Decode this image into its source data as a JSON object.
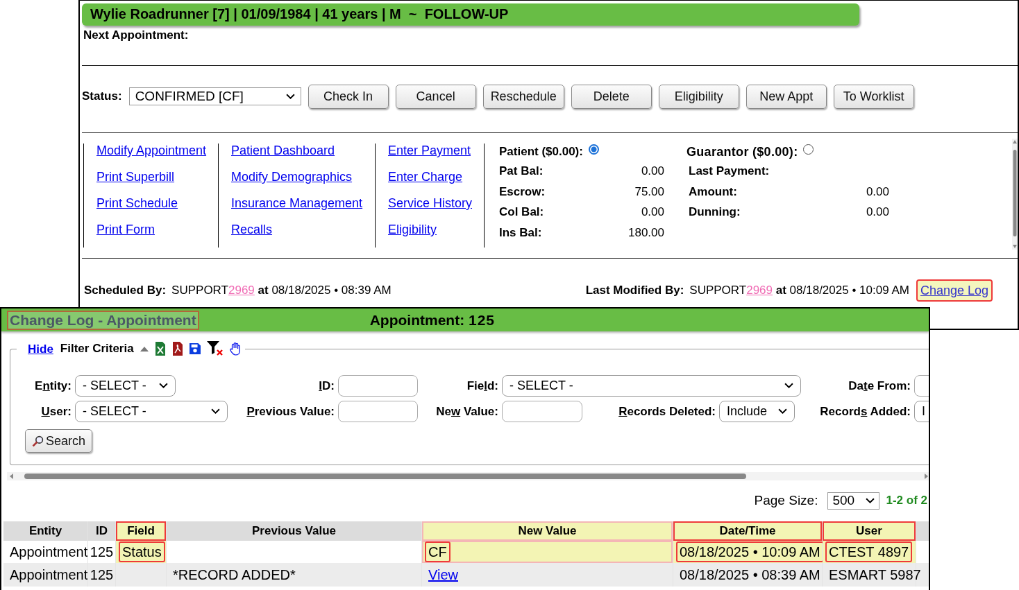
{
  "appointment_window": {
    "banner": "Wylie Roadrunner [7] | 01/09/1984 | 41 years | M  ~  FOLLOW-UP",
    "next_appointment_label": "Next Appointment:",
    "status": {
      "label": "Status:",
      "value": "CONFIRMED [CF]"
    },
    "buttons": [
      "Check In",
      "Cancel",
      "Reschedule",
      "Delete",
      "Eligibility",
      "New Appt",
      "To Worklist"
    ],
    "link_columns": [
      [
        "Modify Appointment",
        "Print Superbill",
        "Print Schedule",
        "Print Form"
      ],
      [
        "Patient Dashboard",
        "Modify Demographics",
        "Insurance Management",
        "Recalls"
      ],
      [
        "Enter Payment",
        "Enter Charge",
        "Service History",
        "Eligibility"
      ]
    ],
    "balances": [
      {
        "label": "Patient ($0.00):",
        "selected": true,
        "rows": [
          {
            "label": "Pat Bal:",
            "value": "0.00"
          },
          {
            "label": "Escrow:",
            "value": "75.00"
          },
          {
            "label": "Col Bal:",
            "value": "0.00"
          },
          {
            "label": "Ins Bal:",
            "value": "180.00"
          }
        ]
      },
      {
        "label": "Guarantor ($0.00):",
        "selected": false,
        "rows": [
          {
            "label": "Last Payment:"
          },
          {
            "label": "Amount:",
            "value": "0.00"
          },
          {
            "label": "Dunning:",
            "value": "0.00"
          }
        ]
      }
    ],
    "scheduled_by": {
      "label": "Scheduled By:",
      "user": "SUPPORT",
      "user_id": "2969",
      "at": "at",
      "datetime": "08/18/2025 • 08:39 AM"
    },
    "last_modified_by": {
      "label": "Last Modified By:",
      "user": "SUPPORT",
      "user_id": "2969",
      "at": "at",
      "datetime": "08/18/2025 • 10:09 AM"
    },
    "change_log_link": {
      "label": "Change Log",
      "highlighted": true
    }
  },
  "change_log_window": {
    "title": "Change Log - Appointment",
    "title_highlighted": true,
    "record_label": "Appointment:",
    "record_id": "125",
    "filter": {
      "hide_link": "Hide",
      "label": "Filter Criteria",
      "rows": [
        [
          {
            "kind": "select",
            "before": "E",
            "key": "n",
            "after": "tity:",
            "value": "- SELECT -"
          },
          {
            "kind": "input",
            "key": "I",
            "after": "D:"
          },
          {
            "kind": "select",
            "before": "Fie",
            "key": "l",
            "after": "d:",
            "value": "- SELECT -"
          },
          "",
          {
            "kind": "input",
            "before": "Da",
            "key": "t",
            "after": "e From:"
          }
        ],
        [
          {
            "kind": "select",
            "key": "U",
            "after": "ser:",
            "value": "- SELECT -"
          },
          {
            "kind": "input",
            "key": "P",
            "after": "revious Value:"
          },
          {
            "kind": "input",
            "before": "Ne",
            "key": "w",
            "after": " Value:"
          },
          {
            "kind": "select",
            "key": "R",
            "after": "ecords Deleted:",
            "value": "Include"
          },
          {
            "kind": "select",
            "before": "Record",
            "key": "s",
            "after": " Added:",
            "value": "I"
          }
        ]
      ],
      "search_button": "Search"
    },
    "page_size": {
      "label": "Page Size:",
      "value": "500",
      "count": "1-2 of 2"
    },
    "table": {
      "columns": [
        {
          "label": "Entity",
          "highlighted": false,
          "outlined": false
        },
        {
          "label": "ID",
          "highlighted": false,
          "outlined": false
        },
        {
          "label": "Field",
          "highlighted": true,
          "outlined": true
        },
        {
          "label": "Previous Value",
          "highlighted": false,
          "outlined": false
        },
        {
          "label": "New Value",
          "highlighted": true,
          "outlined": false
        },
        {
          "label": "Date/Time",
          "highlighted": true,
          "outlined": true
        },
        {
          "label": "User",
          "highlighted": true,
          "outlined": true
        }
      ],
      "rows": [
        [
          {
            "kind": "text",
            "text": "Appointment",
            "highlighted": false,
            "outlined": false
          },
          {
            "kind": "text",
            "text": "125",
            "highlighted": false,
            "outlined": false
          },
          {
            "kind": "text",
            "text": "Status",
            "highlighted": true,
            "outlined": true
          },
          {
            "kind": "text",
            "highlighted": false,
            "outlined": false
          },
          {
            "kind": "text",
            "text": "CF",
            "highlighted": true,
            "outlined": true
          },
          {
            "kind": "text",
            "text": "08/18/2025 • 10:09 AM",
            "highlighted": true,
            "outlined": true
          },
          {
            "kind": "text",
            "text": "CTEST 4897",
            "highlighted": true,
            "outlined": true
          }
        ],
        [
          {
            "kind": "text",
            "text": "Appointment",
            "highlighted": false,
            "outlined": false
          },
          {
            "kind": "text",
            "text": "125",
            "highlighted": false,
            "outlined": false
          },
          {
            "kind": "text",
            "highlighted": false,
            "outlined": false
          },
          {
            "kind": "text",
            "text": "*RECORD ADDED*",
            "highlighted": false,
            "outlined": false
          },
          {
            "kind": "link",
            "text": "View",
            "highlighted": false,
            "outlined": false
          },
          {
            "kind": "text",
            "text": "08/18/2025 • 08:39 AM",
            "highlighted": false,
            "outlined": false
          },
          {
            "kind": "text",
            "text": "ESMART 5987",
            "highlighted": false,
            "outlined": false
          }
        ]
      ]
    }
  }
}
